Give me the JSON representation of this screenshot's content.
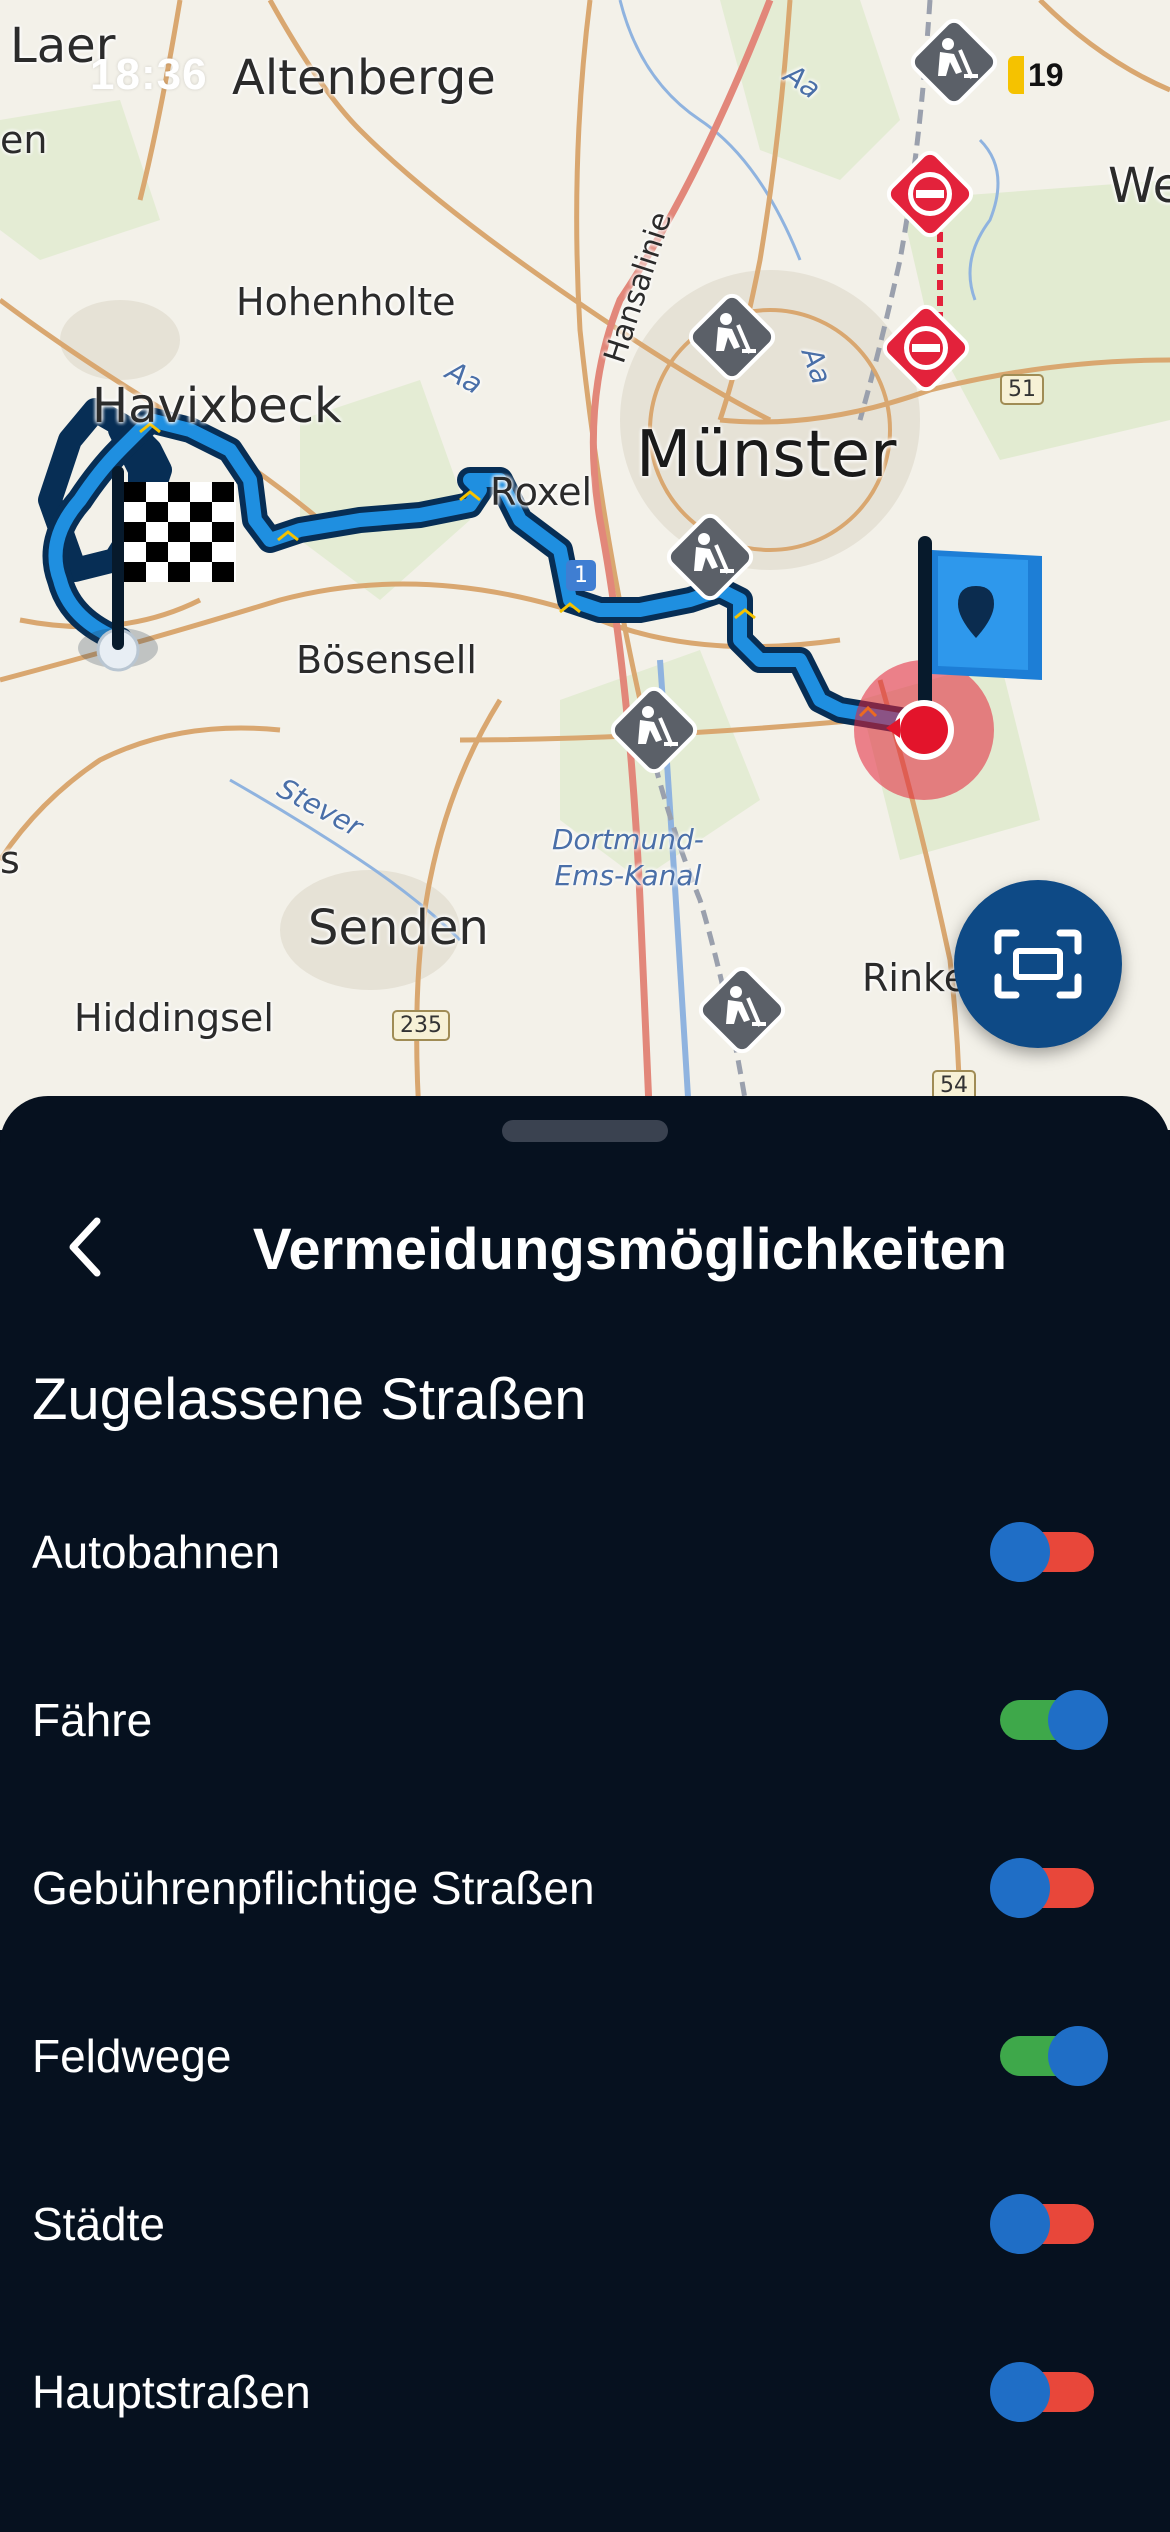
{
  "status_bar": {
    "time": "18:36",
    "battery": "19"
  },
  "map": {
    "places": {
      "laer": "Laer",
      "altenberge": "Altenberge",
      "we": "We",
      "en": "en",
      "hohenholte": "Hohenholte",
      "havixbeck": "Havixbeck",
      "muenster": "Münster",
      "roxel": "Roxel",
      "boesensell": "Bösensell",
      "senden": "Senden",
      "hiddingsel": "Hiddingsel",
      "rinke": "Rinke",
      "s": "s",
      "hansalinie": "Hansalinie",
      "stever": "Stever",
      "aa1": "Aa",
      "aa2": "Aa",
      "aa3": "Aa",
      "canal": "Dortmund-\nEms-Kanal"
    },
    "road_shields": {
      "r51": "51",
      "r235": "235",
      "r54": "54",
      "a1": "1"
    },
    "icons": [
      "roadworks-icon",
      "no-entry-icon",
      "finish-flag-icon",
      "start-flag-icon",
      "recenter-icon"
    ],
    "route_color": "#0d5fa8"
  },
  "sheet": {
    "title": "Vermeidungsmöglichkeiten",
    "section_title": "Zugelassene Straßen",
    "options": [
      {
        "label": "Autobahnen",
        "enabled": false
      },
      {
        "label": "Fähre",
        "enabled": true
      },
      {
        "label": "Gebührenpflichtige Straßen",
        "enabled": false
      },
      {
        "label": "Feldwege",
        "enabled": true
      },
      {
        "label": "Städte",
        "enabled": false
      },
      {
        "label": "Hauptstraßen",
        "enabled": false
      }
    ]
  },
  "colors": {
    "sheet_bg": "#06111f",
    "toggle_on": "#3ea84a",
    "toggle_off": "#e8473a",
    "knob": "#1f6ec6",
    "no_entry": "#e3223b",
    "roadworks": "#5b6068"
  }
}
